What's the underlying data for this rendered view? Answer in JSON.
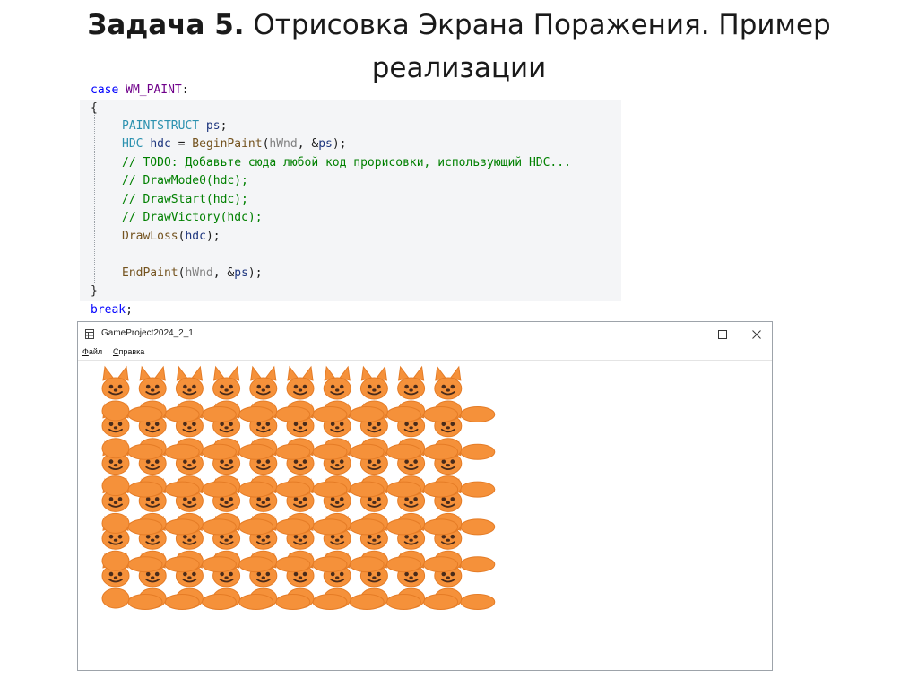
{
  "slide": {
    "title_bold": "Задача 5.",
    "title_rest": " Отрисовка Экрана Поражения. Пример",
    "title_line2": "реализации"
  },
  "code": {
    "case_kw": "case",
    "case_macro": "WM_PAINT",
    "case_colon": ":",
    "open_brace": "{",
    "ps_type": "PAINTSTRUCT",
    "ps_var": "ps",
    "ps_semi": ";",
    "hdc_type": "HDC",
    "hdc_var": "hdc",
    "hdc_eq": " = ",
    "begin_fn": "BeginPaint",
    "begin_open": "(",
    "hwnd_param": "hWnd",
    "begin_mid": ", &",
    "begin_ps": "ps",
    "begin_close": ");",
    "todo_comment": "// TODO: Добавьте сюда любой код прорисовки, использующий HDC...",
    "comment_mode0": "// DrawMode0(hdc);",
    "comment_start": "// DrawStart(hdc);",
    "comment_victory": "// DrawVictory(hdc);",
    "drawloss_fn": "DrawLoss",
    "drawloss_open": "(",
    "drawloss_arg": "hdc",
    "drawloss_close": ");",
    "end_fn": "EndPaint",
    "end_open": "(",
    "end_hwnd": "hWnd",
    "end_mid": ", &",
    "end_ps": "ps",
    "end_close": ");",
    "close_brace": "}",
    "break_kw": "break",
    "break_semi": ";"
  },
  "window": {
    "title": "GameProject2024_2_1",
    "icon": "app-window-icon",
    "minimize_icon": "minimize-icon",
    "maximize_icon": "maximize-icon",
    "close_icon": "close-icon",
    "menu": [
      {
        "label": "Файл"
      },
      {
        "label": "Справка"
      }
    ]
  },
  "game": {
    "fox_rows": 6,
    "fox_columns": 10,
    "fox_color": "#f5913a",
    "fox_outline": "#e57c26",
    "fox_face_color": "#4a2b1a",
    "sprite": "fox-icon"
  }
}
